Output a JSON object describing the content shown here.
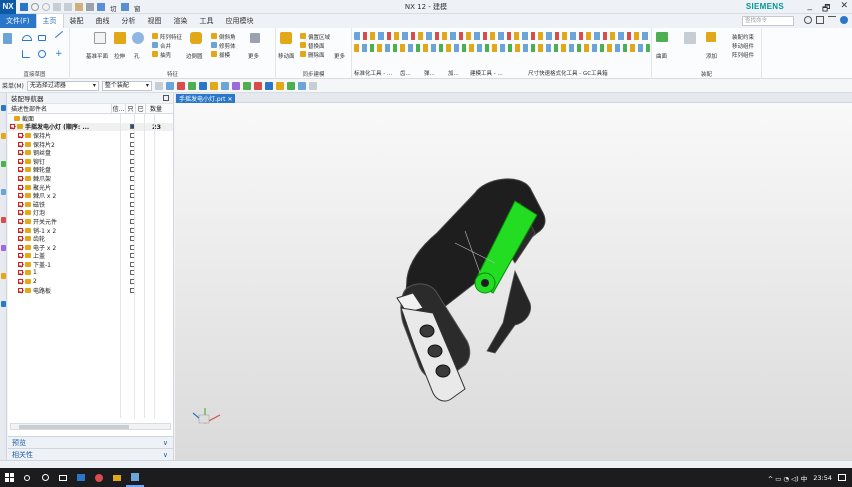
{
  "app": {
    "logo_text": "NX",
    "window_title": "NX 12 - 建模",
    "brand": "SIEMENS",
    "switch_window_label": "切换窗口",
    "window_menu_label": "窗口",
    "window_controls": [
      "_",
      "🗗",
      "✕"
    ]
  },
  "menubar": {
    "file_label": "文件(F)",
    "tabs": [
      "主页",
      "装配",
      "曲线",
      "分析",
      "视图",
      "渲染",
      "工具",
      "应用模块"
    ],
    "active_tab": "主页",
    "search_placeholder": "查找命令"
  },
  "ribbon": {
    "groups": [
      {
        "label": "直接草图"
      },
      {
        "label": "特征"
      },
      {
        "label": "同步建模"
      },
      {
        "label": "装配"
      }
    ],
    "feature_labels": [
      "基准平面",
      "拉伸",
      "孔",
      "阵列特征",
      "合并",
      "抽壳",
      "边倒圆",
      "倒斜角",
      "修剪体",
      "拔模",
      "更多"
    ],
    "sync_labels": [
      "移动面",
      "偏置区域",
      "替换面",
      "删除面",
      "更多"
    ],
    "assembly_labels": [
      "曲面",
      "装配约束",
      "移动组件",
      "阵列组件",
      "添加"
    ],
    "shortcut_groups": [
      "标准化工具 - ...",
      "齿...",
      "弹...",
      "加...",
      "建模工具 - ...",
      "尺寸快速格式化工具 - GC工具箱"
    ]
  },
  "toolbar2": {
    "menu_label": "菜单(M)",
    "filter_value": "无选择过滤器",
    "scope_value": "整个装配"
  },
  "navigator": {
    "title": "装配导航器",
    "columns": [
      "描述性部件名",
      "信...",
      "只",
      "已",
      "数量"
    ],
    "section_row": "截面",
    "rows": [
      {
        "name": "手摇发电小灯 (顺序: ...",
        "count": "23",
        "root": true
      },
      {
        "name": "保持片"
      },
      {
        "name": "保持片2"
      },
      {
        "name": "钢丝盘"
      },
      {
        "name": "铆钉"
      },
      {
        "name": "棘轮盘"
      },
      {
        "name": "棘爪架"
      },
      {
        "name": "聚光片"
      },
      {
        "name": "棘爪 x 2"
      },
      {
        "name": "磁铁"
      },
      {
        "name": "灯泡"
      },
      {
        "name": "开关元件"
      },
      {
        "name": "销-1 x 2"
      },
      {
        "name": "齿轮"
      },
      {
        "name": "电子 x 2"
      },
      {
        "name": "上盖"
      },
      {
        "name": "下盖-1"
      },
      {
        "name": "1"
      },
      {
        "name": "2"
      },
      {
        "name": "电路板"
      }
    ],
    "preview_label": "预览",
    "dependency_label": "相关性"
  },
  "graphics": {
    "doc_tab": "手摇发电小灯.prt ✕"
  },
  "taskbar": {
    "time": "23:54",
    "ime": "中",
    "tray_icons": "^ ▭ ◔ ◁) 中"
  },
  "colors": {
    "accent": "#2a77c9",
    "brand": "#009999",
    "highlight_green": "#22dd22",
    "model_dark": "#1e1e1e"
  }
}
